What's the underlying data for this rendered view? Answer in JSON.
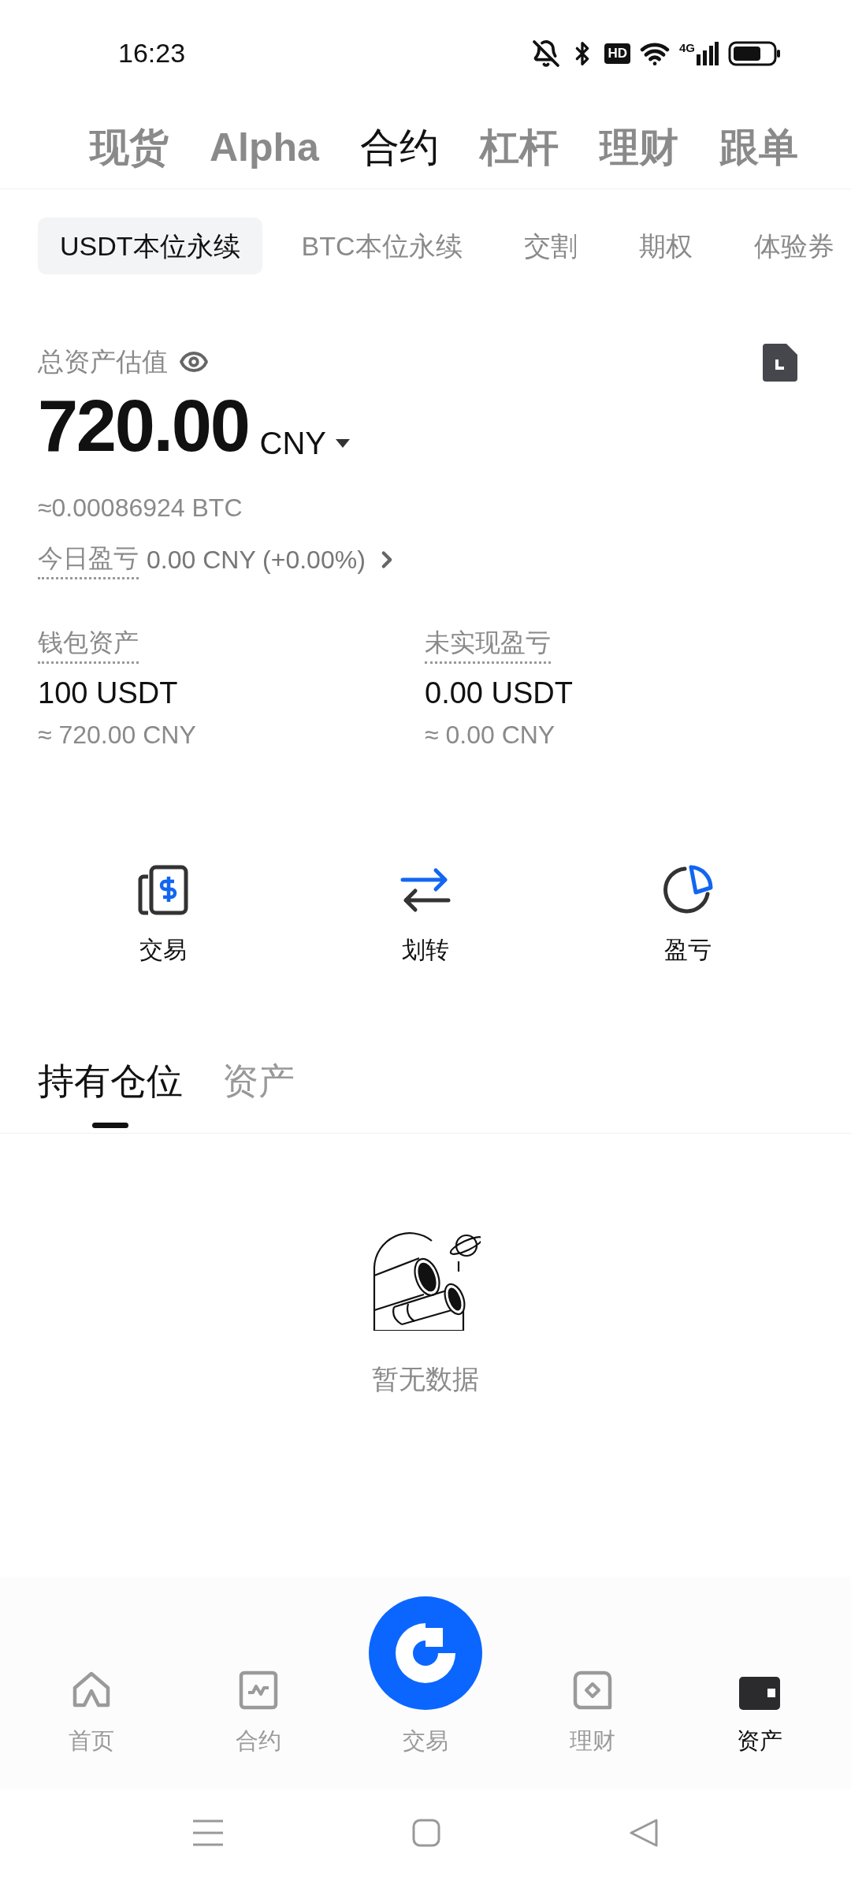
{
  "status_bar": {
    "time": "16:23",
    "hd": "HD",
    "network": "4G"
  },
  "top_tabs": [
    {
      "label": "现货",
      "selected": false
    },
    {
      "label": "Alpha",
      "selected": false
    },
    {
      "label": "合约",
      "selected": true
    },
    {
      "label": "杠杆",
      "selected": false
    },
    {
      "label": "理财",
      "selected": false
    },
    {
      "label": "跟单",
      "selected": false
    }
  ],
  "sub_tabs": [
    {
      "label": "USDT本位永续",
      "selected": true
    },
    {
      "label": "BTC本位永续",
      "selected": false
    },
    {
      "label": "交割",
      "selected": false
    },
    {
      "label": "期权",
      "selected": false
    },
    {
      "label": "体验券",
      "selected": false
    }
  ],
  "total": {
    "label": "总资产估值",
    "value": "720.00",
    "currency": "CNY",
    "btc": "≈0.00086924 BTC",
    "today_label": "今日盈亏",
    "today_value": "0.00 CNY (+0.00%)"
  },
  "balances": [
    {
      "label": "钱包资产",
      "value": "100 USDT",
      "approx": "≈ 720.00 CNY"
    },
    {
      "label": "未实现盈亏",
      "value": "0.00 USDT",
      "approx": "≈ 0.00 CNY"
    }
  ],
  "actions": [
    {
      "kind": "trade",
      "label": "交易"
    },
    {
      "kind": "transfer",
      "label": "划转"
    },
    {
      "kind": "pnl",
      "label": "盈亏"
    }
  ],
  "section_tabs": [
    {
      "label": "持有仓位",
      "selected": true
    },
    {
      "label": "资产",
      "selected": false
    }
  ],
  "empty_state": {
    "message": "暂无数据"
  },
  "bottom_nav": [
    {
      "kind": "home",
      "label": "首页",
      "selected": false
    },
    {
      "kind": "futures",
      "label": "合约",
      "selected": false
    },
    {
      "kind": "trade",
      "label": "交易",
      "selected": false
    },
    {
      "kind": "earn",
      "label": "理财",
      "selected": false
    },
    {
      "kind": "assets",
      "label": "资产",
      "selected": true
    }
  ]
}
